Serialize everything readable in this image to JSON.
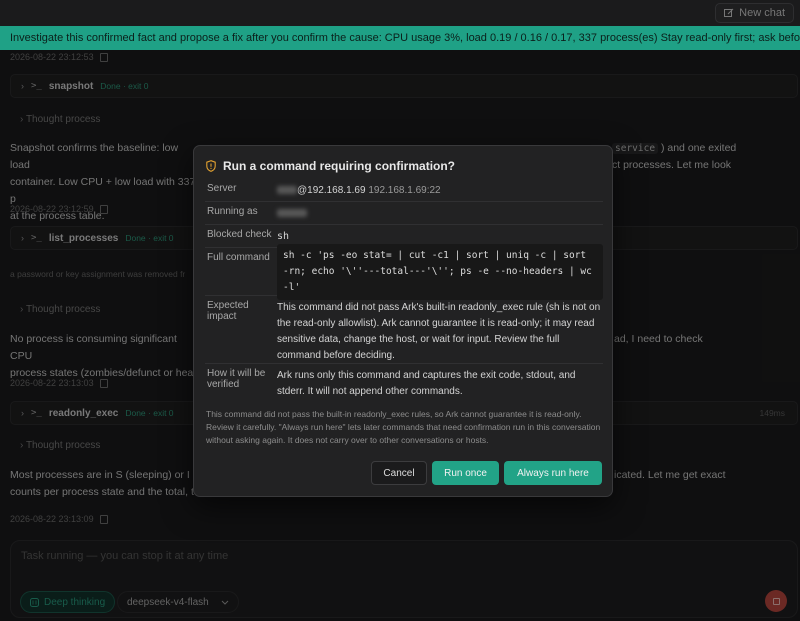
{
  "header": {
    "new_chat_label": "New chat",
    "banner_text": "Investigate this confirmed fact and propose a fix after you confirm the cause: CPU usage 3%, load 0.19 / 0.16 / 0.17, 337 process(es) Stay read-only first; ask before changi..."
  },
  "transcript": {
    "ts1": "2026-08-22 23:12:53",
    "tool1": {
      "name": "snapshot",
      "status": "Done · exit 0"
    },
    "thought1": "Thought process",
    "para1_line1": "Snapshot confirms the baseline: low load",
    "para1_chip": "service",
    "para1_line1_right": ") and one exited",
    "para1_line2": "container. Low CPU + low load with 337 p",
    "para1_line2_right": "ct processes. Let me look",
    "para1_line3": "at the process table.",
    "ts2": "2026-08-22 23:12:59",
    "tool2": {
      "name": "list_processes",
      "status": "Done · exit 0"
    },
    "note": "a password or key assignment was removed fr",
    "thought2": "Thought process",
    "para2_line1": "No process is consuming significant CPU",
    "para2_line1_right": "ad, I need to check",
    "para2_line2": "process states (zombies/defunct or heav",
    "ts3": "2026-08-22 23:13:03",
    "tool3": {
      "name": "readonly_exec",
      "status": "Done · exit 0",
      "ms": "149ms"
    },
    "thought3": "Thought process",
    "para3_line1": "Most processes are in S (sleeping) or I (i",
    "para3_line1_right": "icated. Let me get exact",
    "para3_line2": "counts per process state and the total, to",
    "ts4": "2026-08-22 23:13:09"
  },
  "composer": {
    "placeholder": "Task running — you can stop it at any time",
    "deep_thinking_label": "Deep thinking",
    "model_label": "deepseek-v4-flash"
  },
  "dialog": {
    "title": "Run a command requiring confirmation?",
    "server_label": "Server",
    "server_host": "@192.168.1.69",
    "server_addr": "192.168.1.69:22",
    "running_as_label": "Running as",
    "blocked_label": "Blocked check",
    "blocked_value": "sh",
    "full_command_label": "Full command",
    "full_command": "sh -c 'ps -eo stat= | cut -c1 | sort | uniq -c | sort -rn; echo '\\''---total---'\\''; ps -e --no-headers | wc -l'",
    "impact_label": "Expected impact",
    "impact_text": "This command did not pass Ark's built-in readonly_exec rule (sh is not on the read-only allowlist). Ark cannot guarantee it is read-only; it may read sensitive data, change the host, or wait for input. Review the full command before deciding.",
    "verify_label": "How it will be verified",
    "verify_text": "Ark runs only this command and captures the exit code, stdout, and stderr. It will not append other commands.",
    "footer_text": "This command did not pass the built-in readonly_exec rules, so Ark cannot guarantee it is read-only. Review it carefully. \"Always run here\" lets later commands that need confirmation run in this conversation without asking again. It does not carry over to other conversations or hosts.",
    "cancel_label": "Cancel",
    "run_once_label": "Run once",
    "always_run_label": "Always run here"
  }
}
